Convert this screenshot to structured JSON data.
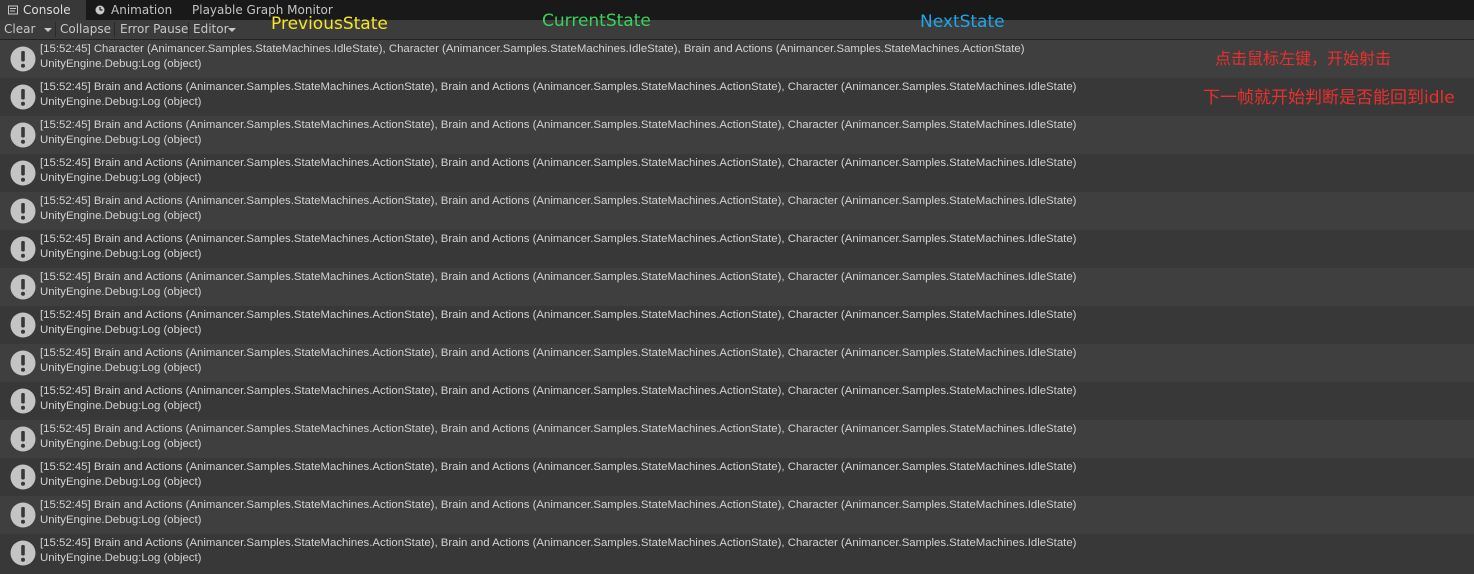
{
  "tabs": [
    {
      "label": "Console",
      "icon": "console-icon",
      "active": true
    },
    {
      "label": "Animation",
      "icon": "clock-icon",
      "active": false
    },
    {
      "label": "Playable Graph Monitor",
      "icon": "",
      "active": false
    }
  ],
  "toolbar": {
    "clear_label": "Clear",
    "collapse_label": "Collapse",
    "error_pause_label": "Error Pause",
    "editor_label": "Editor"
  },
  "annotations": {
    "previous": {
      "text": "PreviousState",
      "color": "#f5e625"
    },
    "current": {
      "text": "CurrentState",
      "color": "#36d35a"
    },
    "next": {
      "text": "NextState",
      "color": "#1ea7e8"
    },
    "note1": {
      "text": "点击鼠标左键，开始射击",
      "color": "#e8302e"
    },
    "note2": {
      "text": "下一帧就开始判断是否能回到idle",
      "color": "#e8302e"
    }
  },
  "log": {
    "icon": "info-icon",
    "entries": [
      {
        "line1": "[15:52:45] Character (Animancer.Samples.StateMachines.IdleState), Character (Animancer.Samples.StateMachines.IdleState), Brain and Actions (Animancer.Samples.StateMachines.ActionState)",
        "line2": "UnityEngine.Debug:Log (object)"
      },
      {
        "line1": "[15:52:45] Brain and Actions (Animancer.Samples.StateMachines.ActionState), Brain and Actions (Animancer.Samples.StateMachines.ActionState), Character (Animancer.Samples.StateMachines.IdleState)",
        "line2": "UnityEngine.Debug:Log (object)"
      },
      {
        "line1": "[15:52:45] Brain and Actions (Animancer.Samples.StateMachines.ActionState), Brain and Actions (Animancer.Samples.StateMachines.ActionState), Character (Animancer.Samples.StateMachines.IdleState)",
        "line2": "UnityEngine.Debug:Log (object)"
      },
      {
        "line1": "[15:52:45] Brain and Actions (Animancer.Samples.StateMachines.ActionState), Brain and Actions (Animancer.Samples.StateMachines.ActionState), Character (Animancer.Samples.StateMachines.IdleState)",
        "line2": "UnityEngine.Debug:Log (object)"
      },
      {
        "line1": "[15:52:45] Brain and Actions (Animancer.Samples.StateMachines.ActionState), Brain and Actions (Animancer.Samples.StateMachines.ActionState), Character (Animancer.Samples.StateMachines.IdleState)",
        "line2": "UnityEngine.Debug:Log (object)"
      },
      {
        "line1": "[15:52:45] Brain and Actions (Animancer.Samples.StateMachines.ActionState), Brain and Actions (Animancer.Samples.StateMachines.ActionState), Character (Animancer.Samples.StateMachines.IdleState)",
        "line2": "UnityEngine.Debug:Log (object)"
      },
      {
        "line1": "[15:52:45] Brain and Actions (Animancer.Samples.StateMachines.ActionState), Brain and Actions (Animancer.Samples.StateMachines.ActionState), Character (Animancer.Samples.StateMachines.IdleState)",
        "line2": "UnityEngine.Debug:Log (object)"
      },
      {
        "line1": "[15:52:45] Brain and Actions (Animancer.Samples.StateMachines.ActionState), Brain and Actions (Animancer.Samples.StateMachines.ActionState), Character (Animancer.Samples.StateMachines.IdleState)",
        "line2": "UnityEngine.Debug:Log (object)"
      },
      {
        "line1": "[15:52:45] Brain and Actions (Animancer.Samples.StateMachines.ActionState), Brain and Actions (Animancer.Samples.StateMachines.ActionState), Character (Animancer.Samples.StateMachines.IdleState)",
        "line2": "UnityEngine.Debug:Log (object)"
      },
      {
        "line1": "[15:52:45] Brain and Actions (Animancer.Samples.StateMachines.ActionState), Brain and Actions (Animancer.Samples.StateMachines.ActionState), Character (Animancer.Samples.StateMachines.IdleState)",
        "line2": "UnityEngine.Debug:Log (object)"
      },
      {
        "line1": "[15:52:45] Brain and Actions (Animancer.Samples.StateMachines.ActionState), Brain and Actions (Animancer.Samples.StateMachines.ActionState), Character (Animancer.Samples.StateMachines.IdleState)",
        "line2": "UnityEngine.Debug:Log (object)"
      },
      {
        "line1": "[15:52:45] Brain and Actions (Animancer.Samples.StateMachines.ActionState), Brain and Actions (Animancer.Samples.StateMachines.ActionState), Character (Animancer.Samples.StateMachines.IdleState)",
        "line2": "UnityEngine.Debug:Log (object)"
      },
      {
        "line1": "[15:52:45] Brain and Actions (Animancer.Samples.StateMachines.ActionState), Brain and Actions (Animancer.Samples.StateMachines.ActionState), Character (Animancer.Samples.StateMachines.IdleState)",
        "line2": "UnityEngine.Debug:Log (object)"
      },
      {
        "line1": "[15:52:45] Brain and Actions (Animancer.Samples.StateMachines.ActionState), Brain and Actions (Animancer.Samples.StateMachines.ActionState), Character (Animancer.Samples.StateMachines.IdleState)",
        "line2": "UnityEngine.Debug:Log (object)"
      }
    ]
  }
}
